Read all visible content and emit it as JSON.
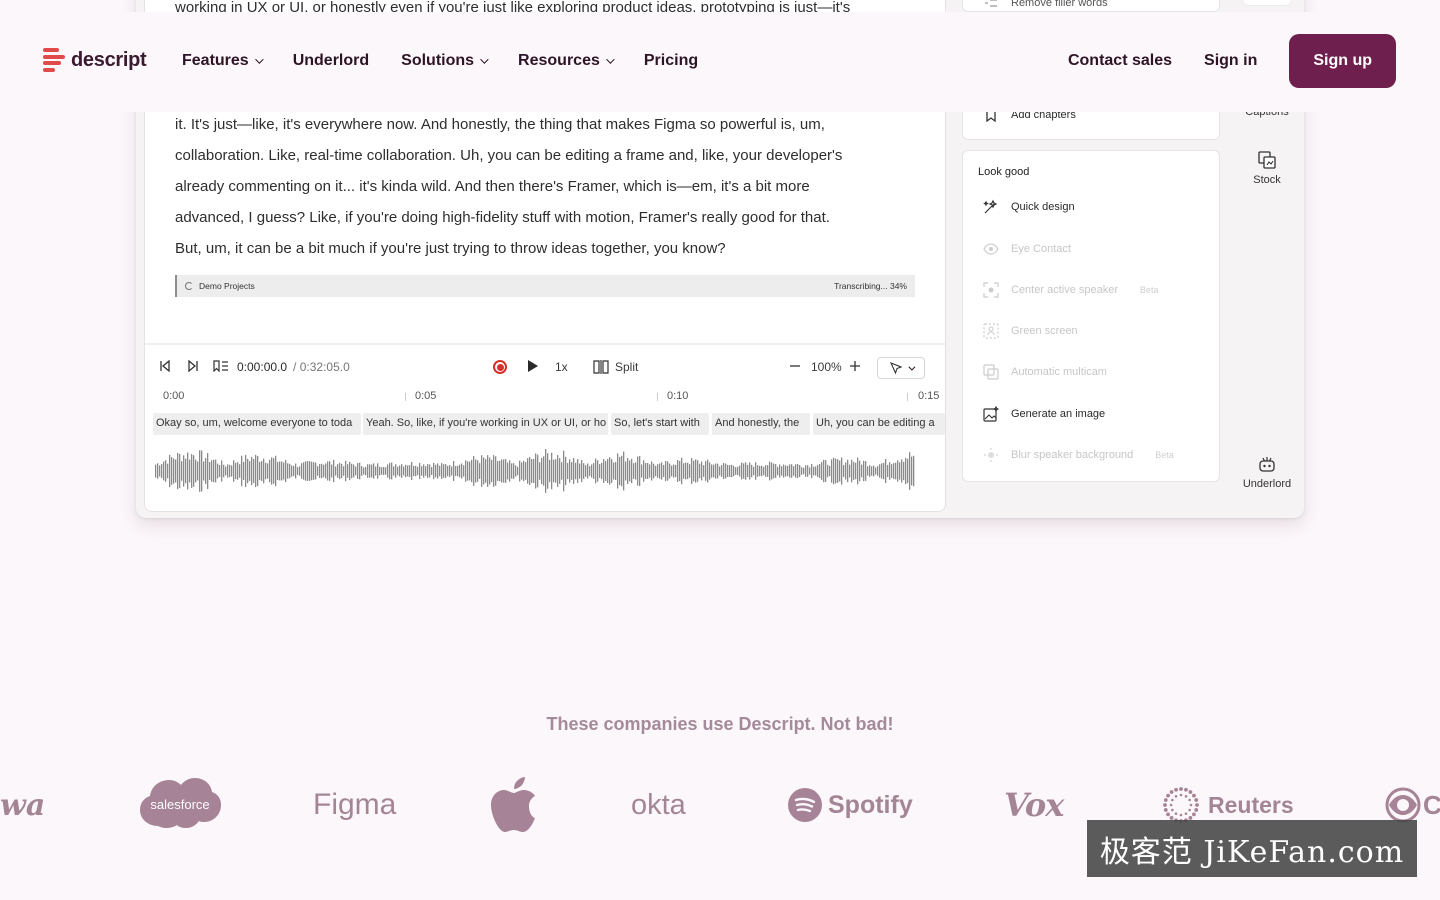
{
  "nav": {
    "brand": "descript",
    "links": [
      {
        "label": "Features",
        "has_dropdown": true
      },
      {
        "label": "Underlord",
        "has_dropdown": false
      },
      {
        "label": "Solutions",
        "has_dropdown": true
      },
      {
        "label": "Resources",
        "has_dropdown": true
      },
      {
        "label": "Pricing",
        "has_dropdown": false
      }
    ],
    "contact_sales": "Contact sales",
    "sign_in": "Sign in",
    "sign_up": "Sign up",
    "colors": {
      "brand_red": "#e14a4a",
      "primary_button": "#6e1f4e"
    }
  },
  "editor": {
    "transcript_top": "working in UX or UI, or honestly even if you're just like exploring product ideas, prototyping is just—it's",
    "transcript_lines": [
      "it. It's just—like, it's everywhere now. And honestly, the thing that makes Figma so powerful is, um,",
      "collaboration. Like, real-time collaboration. Uh, you can be editing a frame and, like, your developer's",
      "already commenting on it... it's kinda wild. And then there's Framer, which is—em, it's a bit more",
      "advanced, I guess? Like, if you're doing high-fidelity stuff with motion, Framer's really good for that.",
      "But, um, it can be a bit much if you're just trying to throw ideas together, you know?"
    ],
    "project_label": "Demo Projects",
    "transcribing_status": "Transcribing... 34%",
    "timecode_current": "0:00:00.0",
    "timecode_total": "/ 0:32:05.0",
    "speed": "1x",
    "split_label": "Split",
    "zoom": "100%",
    "ruler_marks": [
      "0:00",
      "0:05",
      "0:10",
      "0:15"
    ],
    "clips": [
      "Okay so, um, welcome everyone to toda",
      "Yeah. So, like, if you're working in UX or UI, or ho",
      "So, let's start with",
      "And honestly, the",
      "Uh, you can be editing a"
    ]
  },
  "side_panel": {
    "top_item": "Remove filler words",
    "add_chapters": "Add chapters",
    "look_good_title": "Look good",
    "look_good_items": [
      {
        "label": "Quick design",
        "enabled": true,
        "badge": ""
      },
      {
        "label": "Eye Contact",
        "enabled": false,
        "badge": ""
      },
      {
        "label": "Center active speaker",
        "enabled": false,
        "badge": "Beta"
      },
      {
        "label": "Green screen",
        "enabled": false,
        "badge": ""
      },
      {
        "label": "Automatic multicam",
        "enabled": false,
        "badge": ""
      },
      {
        "label": "Generate an image",
        "enabled": true,
        "badge": ""
      },
      {
        "label": "Blur speaker background",
        "enabled": false,
        "badge": "Beta"
      }
    ]
  },
  "rail": {
    "captions": "Captions",
    "stock": "Stock",
    "underlord": "Underlord"
  },
  "companies": {
    "title": "These companies use Descript. Not bad!",
    "logos": [
      "wa",
      "salesforce",
      "Figma",
      "apple",
      "okta",
      "Spotify",
      "Vox",
      "Reuters",
      "C"
    ]
  },
  "watermark": "极客范 JiKeFan.com"
}
